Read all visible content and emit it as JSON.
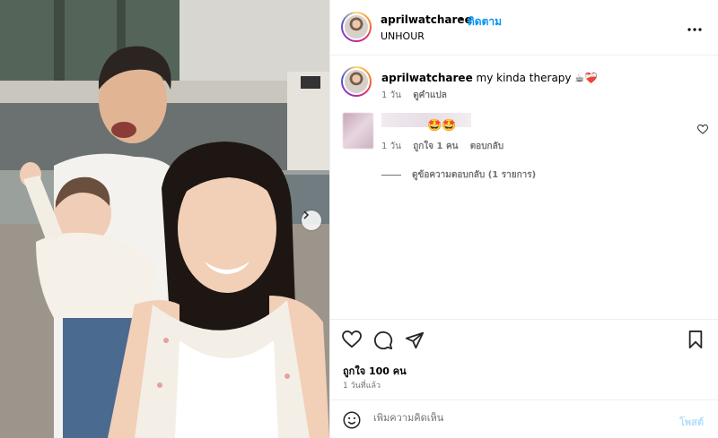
{
  "post": {
    "author": "aprilwatcharee",
    "follow_label": "ติดตาม",
    "subtitle": "UNHOUR",
    "more_icon": "more-horizontal-icon",
    "separator": "•"
  },
  "caption": {
    "author": "aprilwatcharee",
    "text": "my kinda therapy",
    "emoji": "☕❤️‍🩹",
    "age": "1 วัน",
    "translate_label": "ดูคำแปล"
  },
  "comment": {
    "emoji": "🤩🤩",
    "age": "1 วัน",
    "likes_label": "ถูกใจ 1 คน",
    "reply_label": "ตอบกลับ",
    "view_replies_label": "ดูข้อความตอบกลับ (1 รายการ)"
  },
  "actions": {
    "like_icon": "heart-icon",
    "comment_icon": "comment-icon",
    "share_icon": "send-icon",
    "save_icon": "bookmark-icon",
    "likes_text": "ถูกใจ 100 คน",
    "time_text": "1 วันที่แล้ว"
  },
  "composer": {
    "placeholder": "เพิ่มความคิดเห็น",
    "post_label": "โพสต์",
    "emoji_icon": "smiley-icon"
  },
  "colors": {
    "accent": "#0095f6",
    "post_disabled": "#b2dffc",
    "muted": "#737373",
    "border": "#efefef"
  }
}
